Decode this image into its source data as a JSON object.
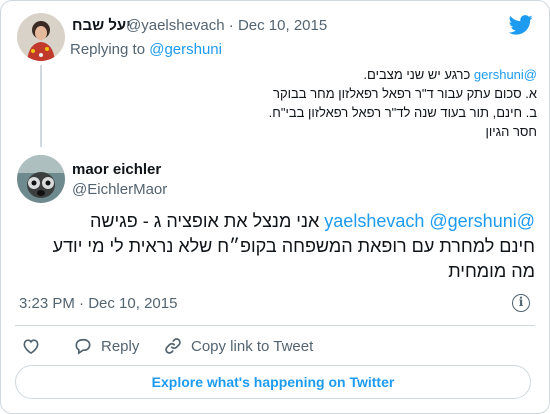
{
  "reply_tweet": {
    "author_name": "יעל שבח",
    "handle": "@yaelshevach",
    "separator": "·",
    "date": "Dec 10, 2015",
    "replying_prefix": "Replying to",
    "replying_to": "@gershuni",
    "line1_mention": "@gershuni",
    "line1_text": " כרגע יש שני מצבים.",
    "line2": "א. סכום עתק עבור ד\"ר רפאל רפאלזון מחר בבוקר",
    "line3": "ב. חינם, תור בעוד שנה לד\"ר רפאל רפאלזון בבי\"ח.",
    "line4": "חסר הגיון"
  },
  "main_tweet": {
    "author_name": "maor eichler",
    "handle": "@EichlerMaor",
    "mention1": "@yaelshevach",
    "mention2": "@gershuni",
    "line1_text": " אני מנצל את אופציה ג - פגישה",
    "line2": "חינם למחרת עם רופאת המשפחה בקופ״ח שלא נראית לי מי יודע",
    "line3": "מה מומחית",
    "time": "3:23 PM",
    "separator": "·",
    "date": "Dec 10, 2015"
  },
  "actions": {
    "reply_label": "Reply",
    "copy_link_label": "Copy link to Tweet"
  },
  "explore_label": "Explore what's happening on Twitter",
  "colors": {
    "accent": "#1d9bf0",
    "text": "#0f1419",
    "muted": "#536471",
    "border": "#cfd9de"
  },
  "icons": [
    "twitter-bird-icon",
    "info-icon",
    "heart-icon",
    "reply-icon",
    "link-icon"
  ]
}
